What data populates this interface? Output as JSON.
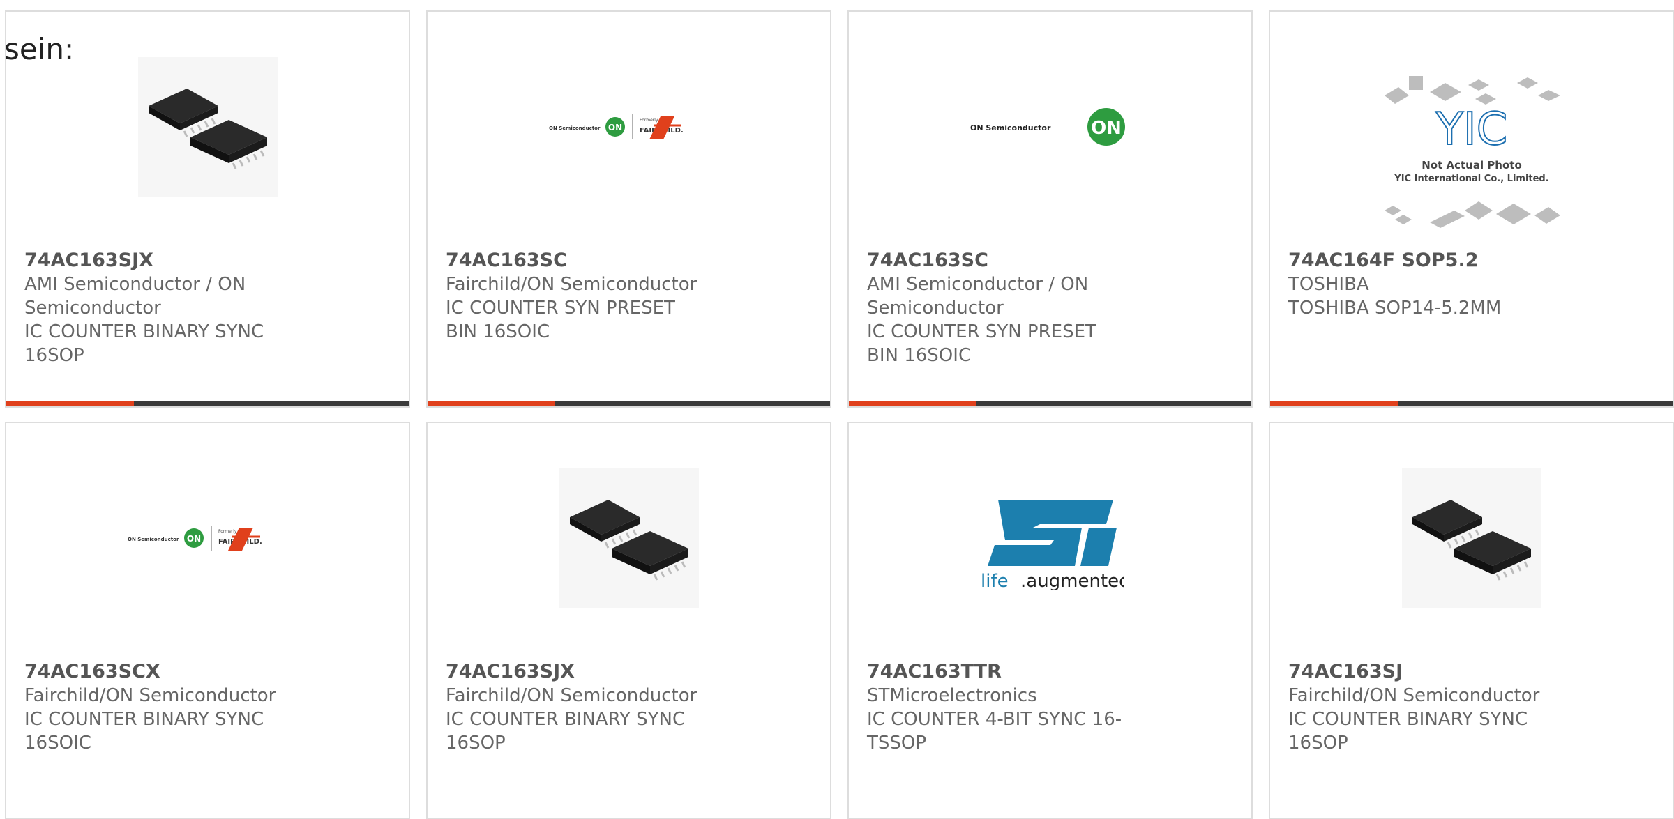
{
  "intro_text": "sein:",
  "colors": {
    "accent": "#e0401c",
    "bar": "#3a3a3a",
    "border": "#dddddd",
    "text": "#555555",
    "on_green": "#2e9c40",
    "st_blue": "#1c7fae"
  },
  "products": [
    {
      "part": "74AC163SJX",
      "manufacturer": "AMI Semiconductor / ON Semiconductor",
      "description": "IC COUNTER BINARY SYNC 16SOP",
      "image": "ic-chip-photo"
    },
    {
      "part": "74AC163SC",
      "manufacturer": "Fairchild/ON Semiconductor",
      "description": "IC COUNTER SYN PRESET BIN 16SOIC",
      "image": "on-fairchild-logo",
      "logo": {
        "on_text": "ON Semiconductor",
        "on_mark": "ON",
        "formerly": "Formerly",
        "fairchild": "FAIRCHILD."
      }
    },
    {
      "part": "74AC163SC",
      "manufacturer": "AMI Semiconductor / ON Semiconductor",
      "description": "IC COUNTER SYN PRESET BIN 16SOIC",
      "image": "on-semi-logo",
      "logo": {
        "on_text": "ON Semiconductor",
        "on_mark": "ON"
      }
    },
    {
      "part": "74AC164F SOP5.2",
      "manufacturer": "TOSHIBA",
      "description": "TOSHIBA SOP14-5.2MM",
      "image": "yic-placeholder",
      "logo": {
        "mark": "YIC",
        "line1": "Not Actual Photo",
        "line2": "YIC International Co., Limited."
      }
    },
    {
      "part": "74AC163SCX",
      "manufacturer": "Fairchild/ON Semiconductor",
      "description": "IC COUNTER BINARY SYNC 16SOIC",
      "image": "on-fairchild-logo",
      "logo": {
        "on_text": "ON Semiconductor",
        "on_mark": "ON",
        "formerly": "Formerly",
        "fairchild": "FAIRCHILD."
      }
    },
    {
      "part": "74AC163SJX",
      "manufacturer": "Fairchild/ON Semiconductor",
      "description": "IC COUNTER BINARY SYNC 16SOP",
      "image": "ic-chip-photo"
    },
    {
      "part": "74AC163TTR",
      "manufacturer": "STMicroelectronics",
      "description": "IC COUNTER 4-BIT SYNC 16-TSSOP",
      "image": "st-logo",
      "logo": {
        "mark": "ST",
        "tagline_a": "life",
        "tagline_b": ".augmented"
      }
    },
    {
      "part": "74AC163SJ",
      "manufacturer": "Fairchild/ON Semiconductor",
      "description": "IC COUNTER BINARY SYNC 16SOP",
      "image": "ic-chip-photo"
    }
  ]
}
